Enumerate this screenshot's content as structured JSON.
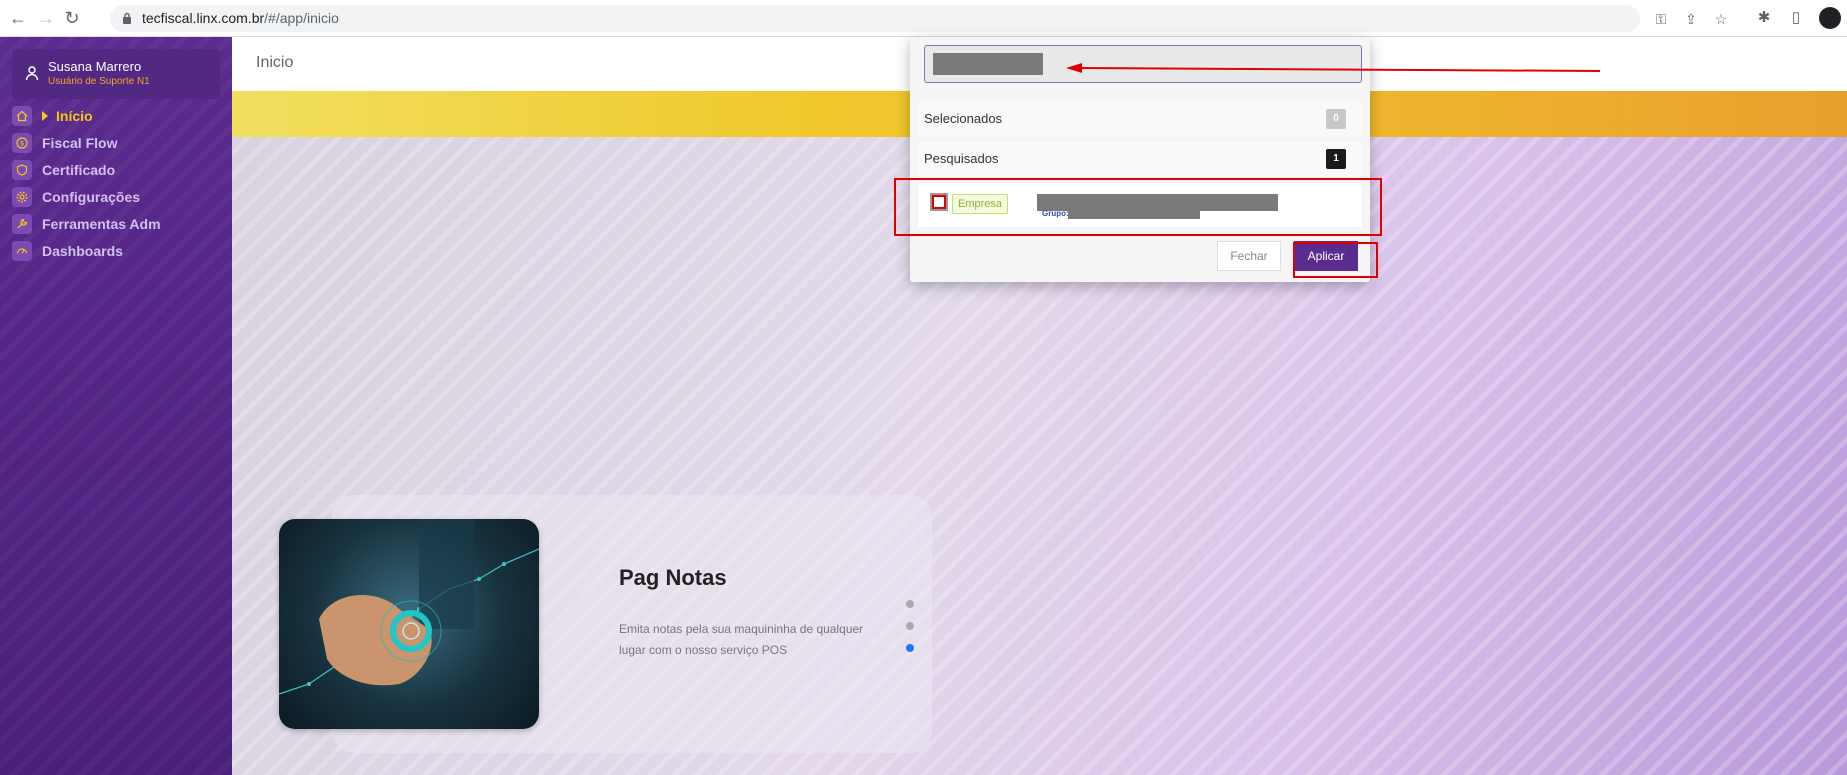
{
  "browser": {
    "url_host": "tecfiscal.linx.com.br",
    "url_path": "/#/app/inicio"
  },
  "sidebar": {
    "user": {
      "name": "Susana Marrero",
      "role": "Usuário de Suporte N1"
    },
    "items": [
      {
        "label": "Início",
        "icon": "home-icon",
        "active": true
      },
      {
        "label": "Fiscal Flow",
        "icon": "dollar-icon",
        "active": false
      },
      {
        "label": "Certificado",
        "icon": "shield-icon",
        "active": false
      },
      {
        "label": "Configurações",
        "icon": "gear-icon",
        "active": false
      },
      {
        "label": "Ferramentas Adm",
        "icon": "wrench-icon",
        "active": false
      },
      {
        "label": "Dashboards",
        "icon": "gauge-icon",
        "active": false
      }
    ]
  },
  "main": {
    "page_title": "Inicio",
    "card": {
      "title": "Pag Notas",
      "text": "Emita notas pela sua maquininha de qualquer lugar com o nosso serviço POS"
    }
  },
  "popup": {
    "selected_label": "Selecionados",
    "selected_count": "0",
    "searched_label": "Pesquisados",
    "searched_count": "1",
    "result": {
      "tag": "Empresa",
      "group_label": "Grupo:"
    },
    "close_label": "Fechar",
    "apply_label": "Aplicar"
  },
  "colors": {
    "sidebar": "#4a1f7a",
    "accent": "#5b2c8f",
    "active_menu": "#f5c518",
    "annotation": "#e00000"
  }
}
